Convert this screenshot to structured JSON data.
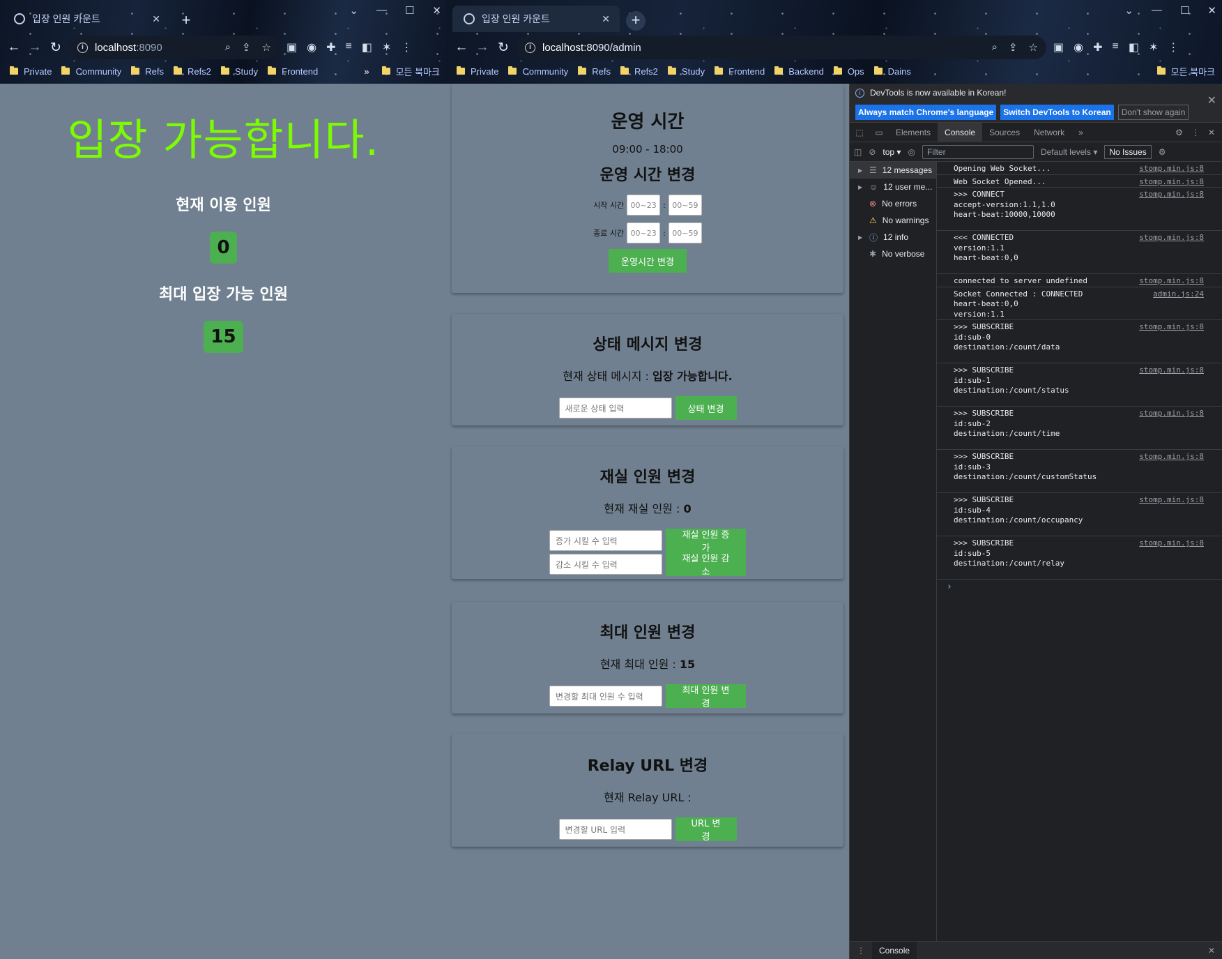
{
  "window1": {
    "tab_title": "입장 인원 카운트",
    "url_host": "localhost",
    "url_port": ":8090",
    "bookmarks": [
      "Private",
      "Community",
      "Refs",
      "Refs2",
      "Study",
      "Frontend"
    ],
    "bookmarks_more": "»",
    "all_bookmarks": "모든 북마크",
    "status_message": "입장 가능합니다.",
    "current_label": "현재 이용 인원",
    "current_count": "0",
    "max_label": "최대 입장 가능 인원",
    "max_count": "15"
  },
  "window2": {
    "tab_title": "입장 인원 카운트",
    "url": "localhost:8090/admin",
    "url_host": "localhost",
    "url_rest": ":8090/admin",
    "bookmarks": [
      "Private",
      "Community",
      "Refs",
      "Refs2",
      "Study",
      "Frontend",
      "Backend",
      "Ops",
      "Dains"
    ],
    "all_bookmarks": "모든 북마크",
    "hours": {
      "title": "운영 시간",
      "value": "09:00 - 18:00",
      "change_title": "운영 시간 변경",
      "start_label": "시작 시간",
      "end_label": "종료 시간",
      "hour_placeholder": "00~23",
      "minute_placeholder": "00~59",
      "colon": ":",
      "button": "운영시간 변경"
    },
    "status": {
      "title": "상태 메시지 변경",
      "current_label": "현재 상태 메시지 : ",
      "current_value": "입장 가능합니다.",
      "placeholder": "새로운 상태 입력",
      "button": "상태 변경"
    },
    "occupancy": {
      "title": "재실 인원 변경",
      "current_label": "현재 재실 인원 : ",
      "current_value": "0",
      "inc_placeholder": "증가 시킬 수 입력",
      "inc_button": "재실 인원 증가",
      "dec_placeholder": "감소 시킬 수 입력",
      "dec_button": "재실 인원 감소"
    },
    "max": {
      "title": "최대 인원 변경",
      "current_label": "현재 최대 인원 : ",
      "current_value": "15",
      "placeholder": "변경할 최대 인원 수 입력",
      "button": "최대 인원 변경"
    },
    "relay": {
      "title": "Relay URL 변경",
      "current_label": "현재 Relay URL : ",
      "placeholder": "변경할 URL 입력",
      "button": "URL 변경"
    }
  },
  "devtools": {
    "notice": "DevTools is now available in Korean!",
    "btn_match": "Always match Chrome's language",
    "btn_switch": "Switch DevTools to Korean",
    "btn_dismiss": "Don't show again",
    "tabs": [
      "Elements",
      "Console",
      "Sources",
      "Network"
    ],
    "active_tab": "Console",
    "context": "top",
    "filter_placeholder": "Filter",
    "levels": "Default levels",
    "issues": "No Issues",
    "sidebar": [
      {
        "label": "12 messages",
        "icon": "list-icon",
        "expand": true
      },
      {
        "label": "12 user me...",
        "icon": "user-icon",
        "expand": true
      },
      {
        "label": "No errors",
        "icon": "error-icon",
        "expand": false
      },
      {
        "label": "No warnings",
        "icon": "warning-icon",
        "expand": false
      },
      {
        "label": "12 info",
        "icon": "info-icon",
        "expand": true
      },
      {
        "label": "No verbose",
        "icon": "bug-icon",
        "expand": false
      }
    ],
    "messages": [
      {
        "text": "Opening Web Socket...",
        "src": "stomp.min.js:8"
      },
      {
        "text": "Web Socket Opened...",
        "src": "stomp.min.js:8"
      },
      {
        "text": ">>> CONNECT\naccept-version:1.1,1.0\nheart-beat:10000,10000\n\n",
        "src": "stomp.min.js:8"
      },
      {
        "text": "<<< CONNECTED\nversion:1.1\nheart-beat:0,0\n\n",
        "src": "stomp.min.js:8"
      },
      {
        "text": "connected to server undefined",
        "src": "stomp.min.js:8"
      },
      {
        "text": "Socket Connected : CONNECTED\nheart-beat:0,0\nversion:1.1",
        "src": "admin.js:24"
      },
      {
        "text": ">>> SUBSCRIBE\nid:sub-0\ndestination:/count/data\n\n",
        "src": "stomp.min.js:8"
      },
      {
        "text": ">>> SUBSCRIBE\nid:sub-1\ndestination:/count/status\n\n",
        "src": "stomp.min.js:8"
      },
      {
        "text": ">>> SUBSCRIBE\nid:sub-2\ndestination:/count/time\n\n",
        "src": "stomp.min.js:8"
      },
      {
        "text": ">>> SUBSCRIBE\nid:sub-3\ndestination:/count/customStatus\n\n",
        "src": "stomp.min.js:8"
      },
      {
        "text": ">>> SUBSCRIBE\nid:sub-4\ndestination:/count/occupancy\n\n",
        "src": "stomp.min.js:8"
      },
      {
        "text": ">>> SUBSCRIBE\nid:sub-5\ndestination:/count/relay\n\n",
        "src": "stomp.min.js:8"
      }
    ],
    "prompt": "›",
    "drawer_tab": "Console"
  }
}
